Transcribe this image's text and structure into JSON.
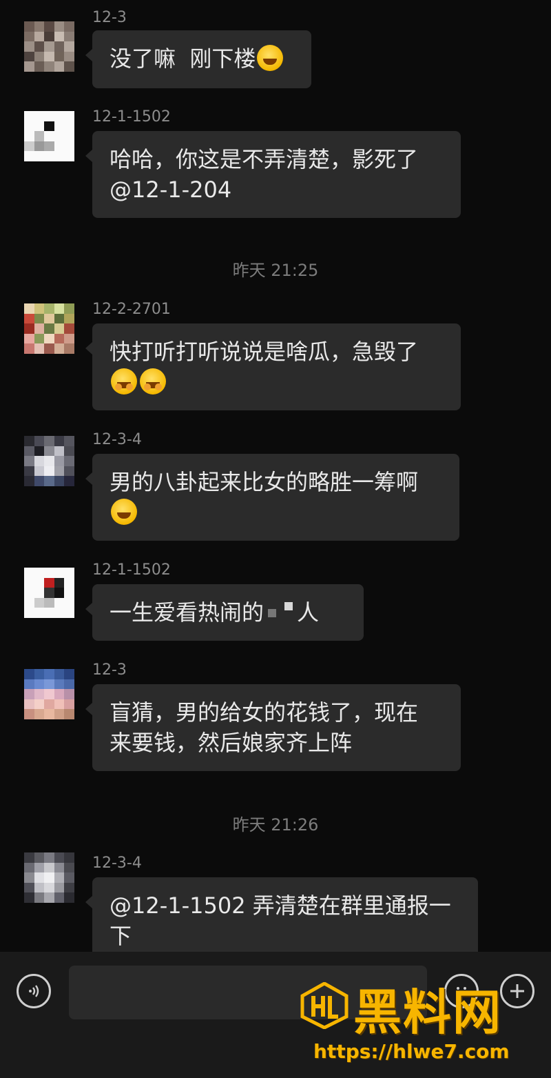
{
  "messages": [
    {
      "sender": "12-3",
      "text": "没了嘛  刚下楼",
      "emojis": [
        "laugh-cry"
      ]
    },
    {
      "sender": "12-1-1502",
      "text": "哈哈，你这是不弄清楚，影死了\n@12-1-204",
      "emojis": []
    },
    {
      "sender": "12-2-2701",
      "text": "快打听打听说说是啥瓜，急毁了",
      "emojis": [
        "hug",
        "hug"
      ]
    },
    {
      "sender": "12-3-4",
      "text": "男的八卦起来比女的略胜一筹啊",
      "emojis": [
        "laugh-cry"
      ]
    },
    {
      "sender": "12-1-1502",
      "text_before": "一生爱看热闹的",
      "text_after": "人",
      "emojis": []
    },
    {
      "sender": "12-3",
      "text": "盲猜，男的给女的花钱了，现在\n来要钱，然后娘家齐上阵",
      "emojis": []
    },
    {
      "sender": "12-3-4",
      "text": "@12-1-1502 弄清楚在群里通报一\n下",
      "emojis": []
    }
  ],
  "timestamps": [
    "昨天 21:25",
    "昨天 21:26"
  ],
  "input_bar": {
    "voice_icon": "voice-icon",
    "emoji_icon": "emoji-icon",
    "plus_icon": "plus-icon"
  },
  "watermark": {
    "title": "黑料网",
    "url": "https://hlwe7.com"
  },
  "colors": {
    "background": "#0b0b0b",
    "bubble": "#2b2b2b",
    "sender_text": "#8d8d8d",
    "watermark": "#f7b500"
  }
}
